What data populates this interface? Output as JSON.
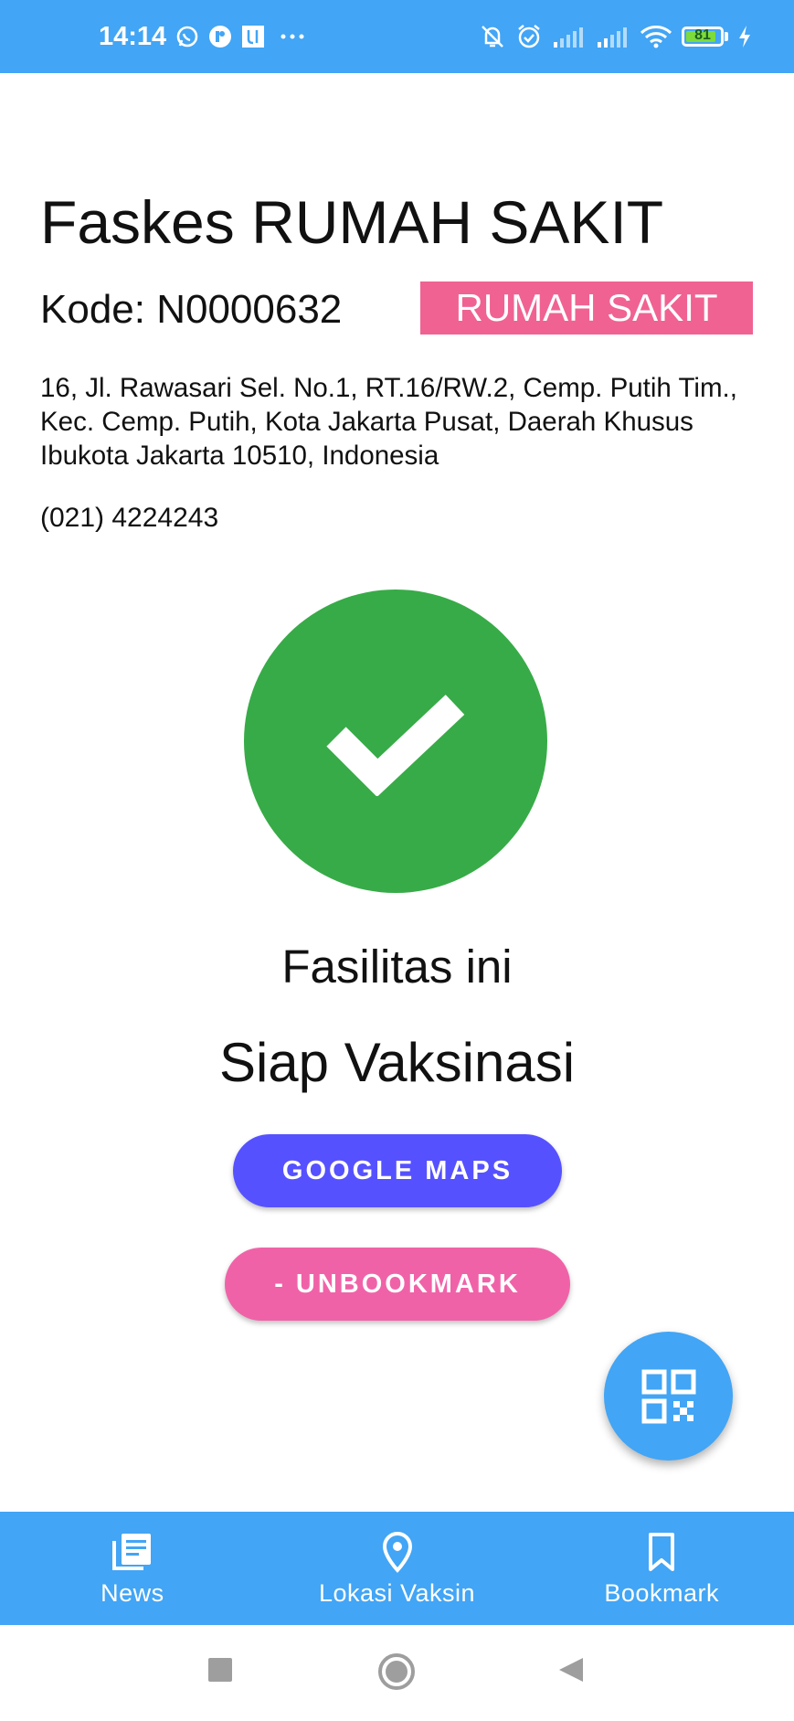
{
  "status_bar": {
    "time": "14:14",
    "battery_level": "81",
    "icons": [
      "whatsapp-icon",
      "app-icon",
      "app-u-icon",
      "more-dots-icon",
      "mute-bell-icon",
      "alarm-icon",
      "signal-icon",
      "signal-icon",
      "wifi-icon",
      "battery-icon",
      "charging-icon"
    ]
  },
  "facility": {
    "title": "Faskes RUMAH SAKIT",
    "code": "Kode: N0000632",
    "type_badge": "RUMAH SAKIT",
    "address": "16, Jl. Rawasari Sel. No.1, RT.16/RW.2, Cemp. Putih Tim., Kec. Cemp. Putih, Kota Jakarta Pusat, Daerah Khusus Ibukota Jakarta 10510, Indonesia",
    "phone": "(021) 4224243"
  },
  "status": {
    "line1": "Fasilitas ini",
    "line2": "Siap Vaksinasi",
    "icon": "check-icon",
    "color": "#37ab47"
  },
  "actions": {
    "maps_label": "GOOGLE MAPS",
    "unbookmark_label": "- UNBOOKMARK",
    "fab_icon": "qr-code-icon"
  },
  "bottom_nav": {
    "items": [
      {
        "label": "News",
        "icon": "news-icon"
      },
      {
        "label": "Lokasi Vaksin",
        "icon": "location-pin-icon"
      },
      {
        "label": "Bookmark",
        "icon": "bookmark-icon"
      }
    ]
  },
  "colors": {
    "primary": "#42a5f5",
    "badge": "#f06292",
    "maps_button": "#5651ff",
    "unbookmark_button": "#f062a8"
  }
}
